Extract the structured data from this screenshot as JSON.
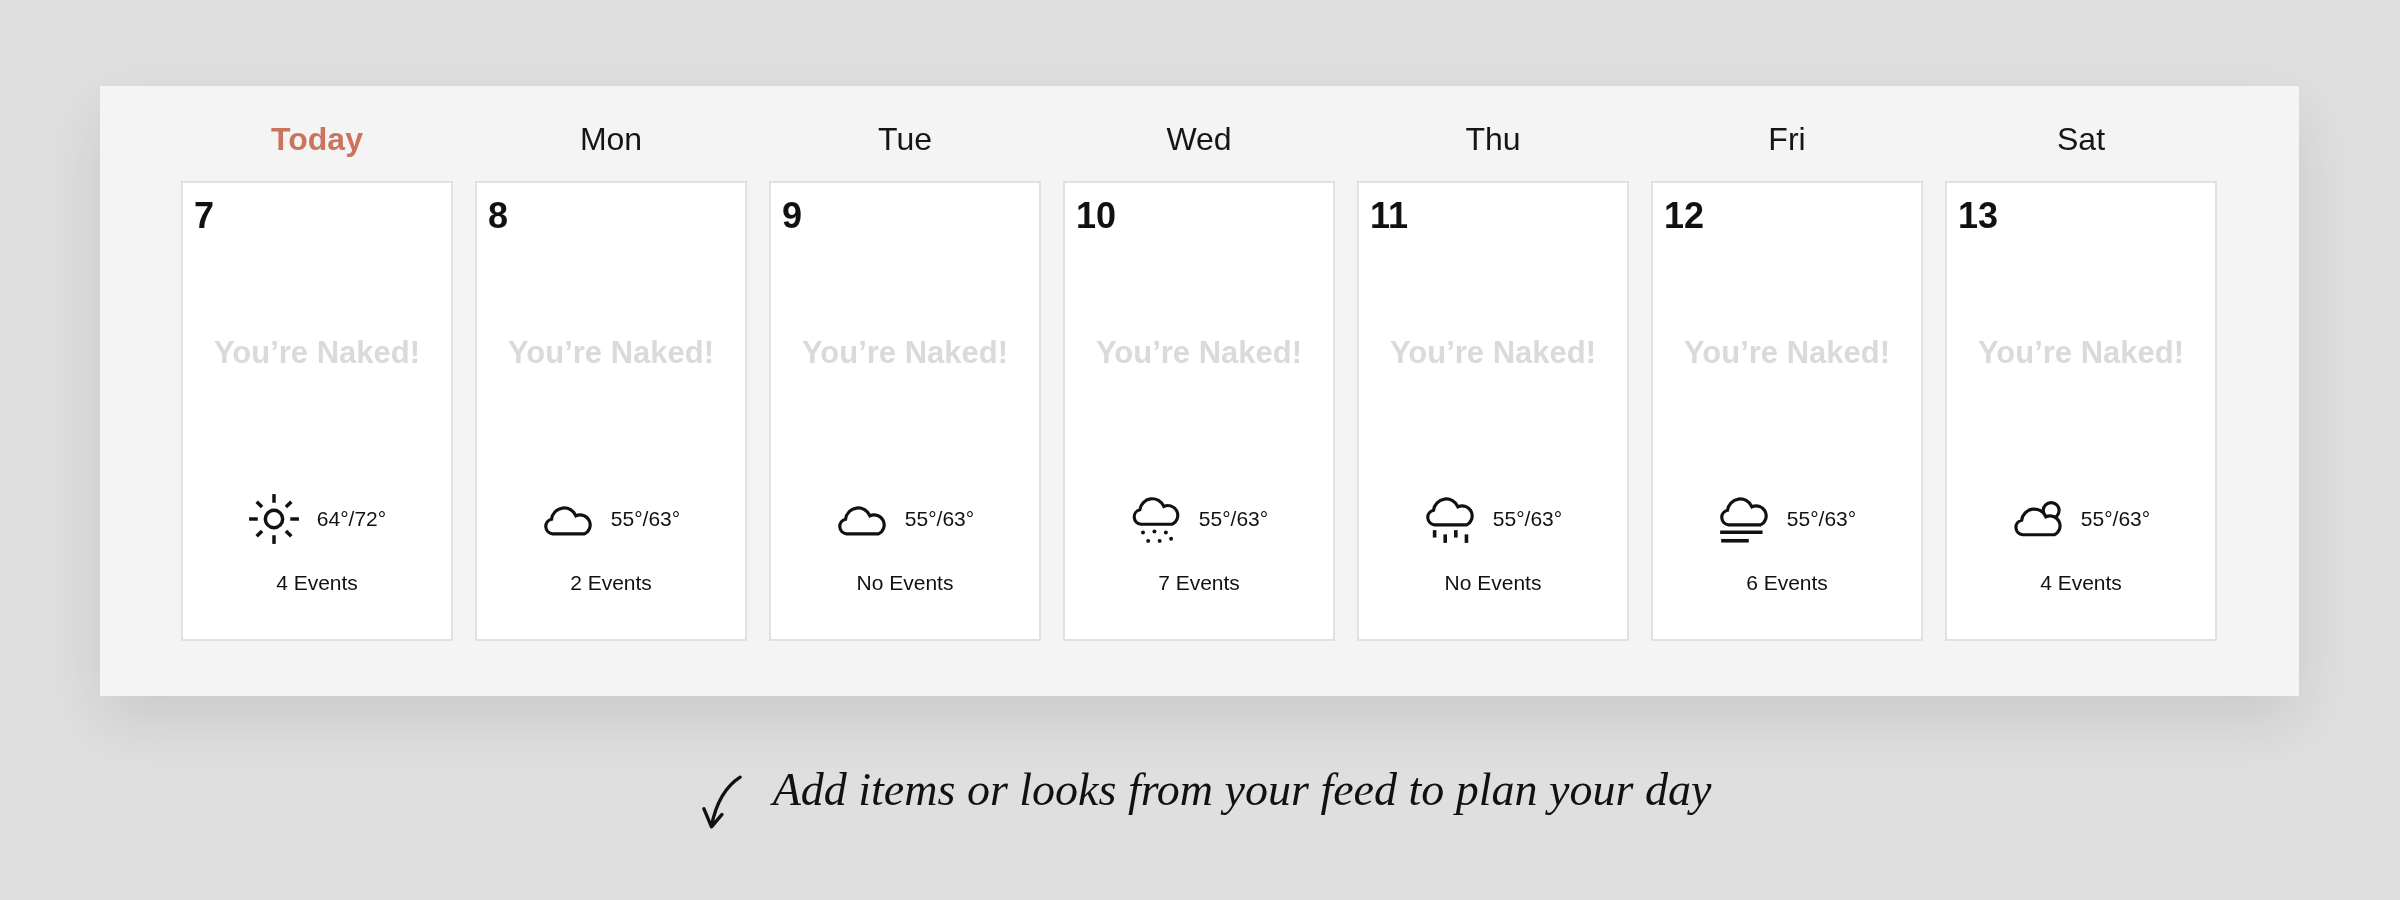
{
  "days": [
    {
      "label": "Today",
      "today": true,
      "date": "7",
      "status": "You’re Naked!",
      "weather": {
        "kind": "sunny",
        "temp": "64°/72°"
      },
      "events": "4 Events"
    },
    {
      "label": "Mon",
      "today": false,
      "date": "8",
      "status": "You’re Naked!",
      "weather": {
        "kind": "cloudy",
        "temp": "55°/63°"
      },
      "events": "2 Events"
    },
    {
      "label": "Tue",
      "today": false,
      "date": "9",
      "status": "You’re Naked!",
      "weather": {
        "kind": "cloudy",
        "temp": "55°/63°"
      },
      "events": "No Events"
    },
    {
      "label": "Wed",
      "today": false,
      "date": "10",
      "status": "You’re Naked!",
      "weather": {
        "kind": "snow",
        "temp": "55°/63°"
      },
      "events": "7 Events"
    },
    {
      "label": "Thu",
      "today": false,
      "date": "11",
      "status": "You’re Naked!",
      "weather": {
        "kind": "rain",
        "temp": "55°/63°"
      },
      "events": "No Events"
    },
    {
      "label": "Fri",
      "today": false,
      "date": "12",
      "status": "You’re Naked!",
      "weather": {
        "kind": "fog",
        "temp": "55°/63°"
      },
      "events": "6 Events"
    },
    {
      "label": "Sat",
      "today": false,
      "date": "13",
      "status": "You’re Naked!",
      "weather": {
        "kind": "partly-cloudy",
        "temp": "55°/63°"
      },
      "events": "4 Events"
    }
  ],
  "hint": "Add items or looks from your feed to plan your day"
}
